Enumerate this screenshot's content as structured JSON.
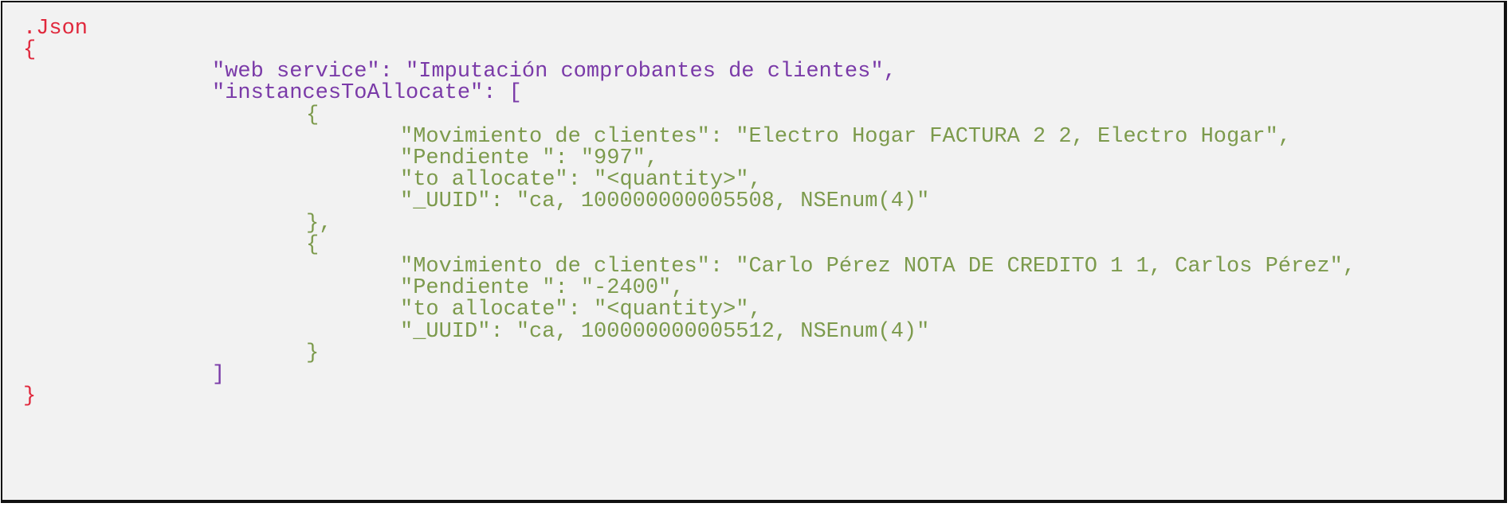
{
  "code": {
    "language_label": ".Json",
    "colors": {
      "background": "#f2f2f2",
      "border": "#111111",
      "top_level": "#e0283c",
      "keys": "#7a3aa8",
      "nested": "#7c9a4c"
    },
    "lines": [
      ".Json",
      "{",
      "\t\t\"web service\": \"Imputación comprobantes de clientes\",",
      "\t\t\"instancesToAllocate\": [",
      "\t\t\t{",
      "\t\t\t\t\"Movimiento de clientes\": \"Electro Hogar FACTURA 2 2, Electro Hogar\",",
      "\t\t\t\t\"Pendiente \": \"997\",",
      "\t\t\t\t\"to allocate\": \"<quantity>\",",
      "\t\t\t\t\"_UUID\": \"ca, 100000000005508, NSEnum(4)\"",
      "\t\t\t},",
      "\t\t\t{",
      "\t\t\t\t\"Movimiento de clientes\": \"Carlo Pérez NOTA DE CREDITO 1 1, Carlos Pérez\",",
      "\t\t\t\t\"Pendiente \": \"-2400\",",
      "\t\t\t\t\"to allocate\": \"<quantity>\",",
      "\t\t\t\t\"_UUID\": \"ca, 100000000005512, NSEnum(4)\"",
      "\t\t\t}",
      "\t\t]",
      "}"
    ]
  }
}
